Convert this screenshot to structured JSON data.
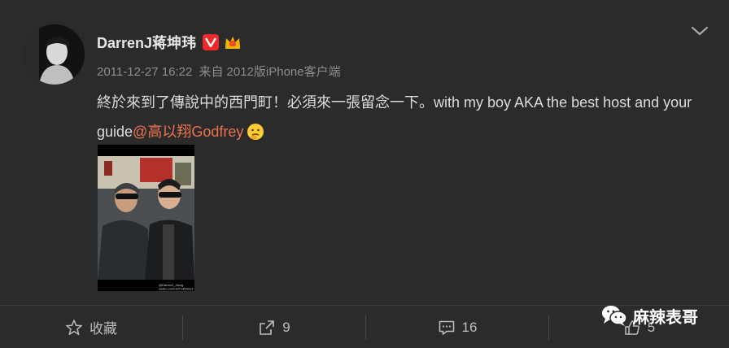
{
  "post": {
    "username": "DarrenJ蒋坤玮",
    "timestamp": "2011-12-27 16:22",
    "source_prefix": "来自",
    "source": "2012版iPhone客户端",
    "text_main": "終於來到了傳說中的西門町！必須來一張留念一下。with my boy AKA the best host and your guide",
    "mention": "@高以翔Godfrey",
    "verified_badge_label": "V",
    "photo_caption_line1": "@DarrenJ_Jiang",
    "photo_caption_line2": "weibo.com/1871450313"
  },
  "actions": {
    "favorite_label": "收藏",
    "repost_count": "9",
    "comment_count": "16",
    "like_count": "5"
  },
  "watermark": {
    "text": "麻辣表哥"
  },
  "icons": {
    "verified": "verified-v-icon",
    "vip": "crown-icon",
    "more": "chevron-down-icon",
    "favorite": "star-icon",
    "repost": "share-icon",
    "comment": "comment-icon",
    "like": "thumbs-up-icon",
    "emoji": "thinking-emoji-icon",
    "watermark": "wechat-icon"
  },
  "colors": {
    "background": "#2b2b2c",
    "mention": "#eb7350",
    "verified": "#f02a2a"
  }
}
